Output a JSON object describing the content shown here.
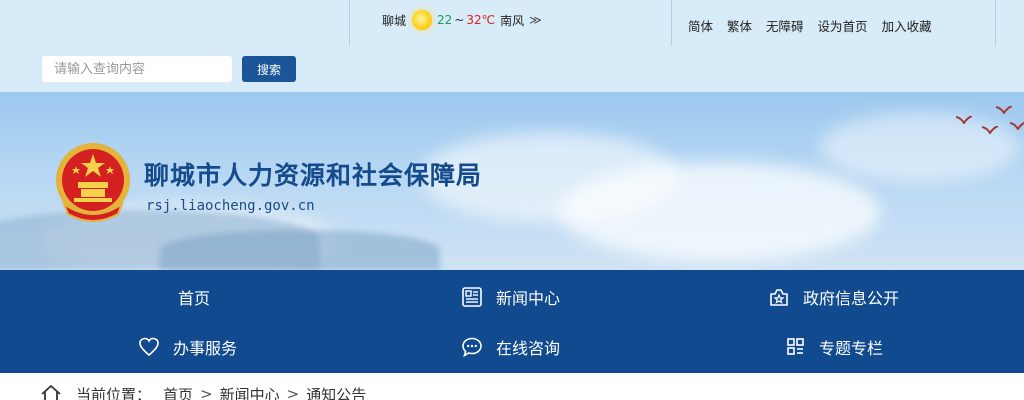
{
  "weather": {
    "city": "聊城",
    "icon": "sun-icon",
    "temp_low": "22",
    "temp_sep": "~",
    "temp_high": "32℃",
    "wind": "南风",
    "more_glyph": "≫"
  },
  "top_links": [
    "简体",
    "繁体",
    "无障碍",
    "设为首页",
    "加入收藏"
  ],
  "search": {
    "placeholder": "请输入查询内容",
    "button_label": "搜索"
  },
  "site": {
    "title": "聊城市人力资源和社会保障局",
    "url": "rsj.liaocheng.gov.cn",
    "emblem": "national-emblem-icon"
  },
  "nav": {
    "items": [
      {
        "label": "首页",
        "icon": ""
      },
      {
        "label": "新闻中心",
        "icon": "newspaper-icon"
      },
      {
        "label": "政府信息公开",
        "icon": "info-disclosure-icon"
      },
      {
        "label": "办事服务",
        "icon": "heart-icon"
      },
      {
        "label": "在线咨询",
        "icon": "chat-bubble-icon"
      },
      {
        "label": "专题专栏",
        "icon": "grid-icon"
      }
    ]
  },
  "breadcrumb": {
    "label": "当前位置：",
    "items": [
      "首页",
      "新闻中心",
      "通知公告"
    ],
    "separator": ">"
  },
  "colors": {
    "topbar_bg": "#d8ebf8",
    "nav_bg": "#114a8f",
    "title": "#154b8c",
    "search_button": "#1c5498",
    "temp_low": "#15a05a",
    "temp_high": "#e02020"
  }
}
